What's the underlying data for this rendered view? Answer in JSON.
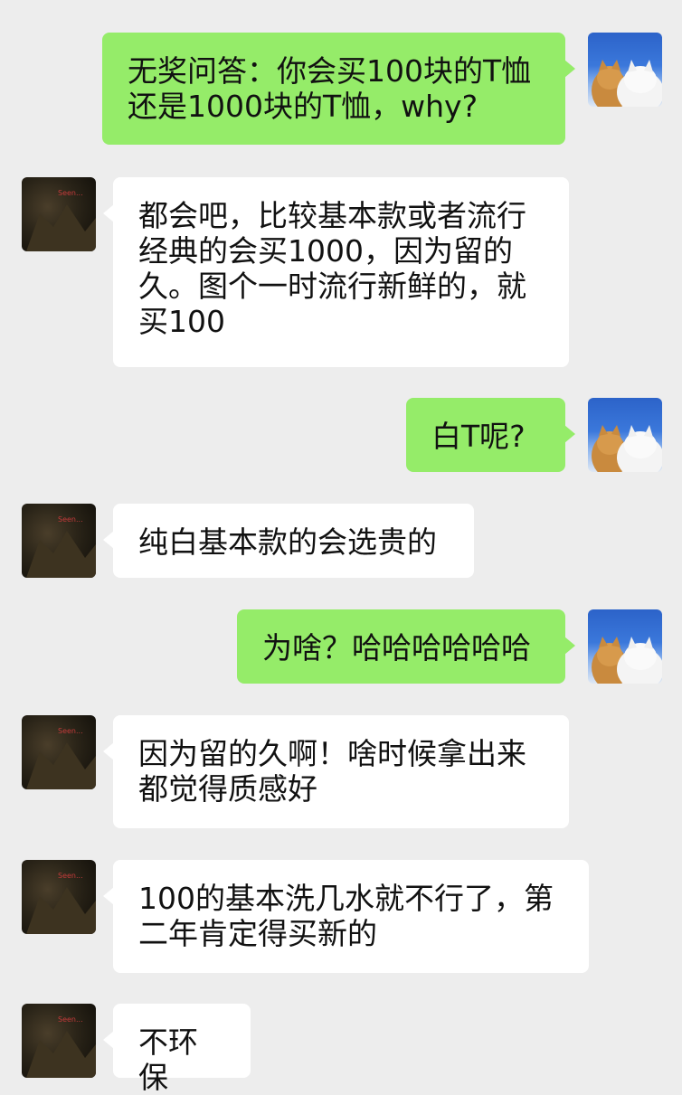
{
  "messages": [
    {
      "from": "me",
      "text": "无奖问答：你会买100块的T恤\n还是1000块的T恤，why?"
    },
    {
      "from": "other",
      "text": "都会吧，比较基本款或者流行\n经典的会买1000，因为留的\n久。图个一时流行新鲜的，就\n买100"
    },
    {
      "from": "me",
      "text": "白T呢?"
    },
    {
      "from": "other",
      "text": "纯白基本款的会选贵的"
    },
    {
      "from": "me",
      "text": "为啥？哈哈哈哈哈哈"
    },
    {
      "from": "other",
      "text": "因为留的久啊！啥时候拿出来\n都觉得质感好"
    },
    {
      "from": "other",
      "text": "100的基本洗几水就不行了，第\n二年肯定得买新的"
    },
    {
      "from": "other",
      "text": "不环保"
    }
  ],
  "avatars": {
    "me": {
      "icon": "cats-avatar-icon"
    },
    "other": {
      "icon": "dark-photo-avatar-icon",
      "overlay_text": "Seen..."
    }
  }
}
